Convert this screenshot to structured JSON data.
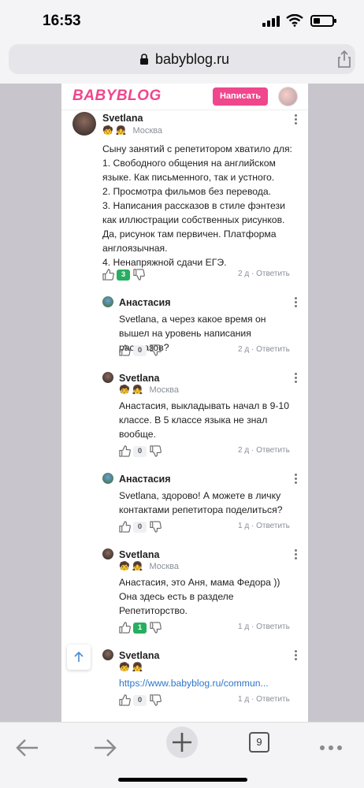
{
  "status": {
    "time": "16:53",
    "battery_level": 0.35
  },
  "browser": {
    "url": "babyblog.ru",
    "tab_count": "9"
  },
  "site": {
    "logo": "BABYBLOG",
    "write_button": "Написать"
  },
  "comments": [
    {
      "author": "Svetlana",
      "badges": "🧒 👧",
      "city": "Москва",
      "text": "Сыну занятий с репетитором хватило для:\n1. Свободного общения на английском языке. Как письменного, так и устного.\n2. Просмотра фильмов без перевода.\n3. Написания рассказов в стиле фэнтези как иллюстрации собственных рисунков. Да, рисунок там первичен. Платформа англоязычная.\n4. Ненапряжной сдачи ЕГЭ.",
      "likes": "3",
      "time": "2 д",
      "reply": "Ответить"
    },
    {
      "author": "Анастасия",
      "text": "Svetlana, а через какое время он вышел на уровень написания рассказов?",
      "likes": "0",
      "time": "2 д",
      "reply": "Ответить"
    },
    {
      "author": "Svetlana",
      "badges": "🧒 👧",
      "city": "Москва",
      "text": "Анастасия, выкладывать начал в 9-10 классе. В 5 классе языка не знал вообще.",
      "likes": "0",
      "time": "2 д",
      "reply": "Ответить"
    },
    {
      "author": "Анастасия",
      "text": "Svetlana, здорово! А можете в личку контактами репетитора поделиться?",
      "likes": "0",
      "time": "1 д",
      "reply": "Ответить"
    },
    {
      "author": "Svetlana",
      "badges": "🧒 👧",
      "city": "Москва",
      "text": "Анастасия, это Аня, мама Федора ))\nОна здесь есть в разделе Репетиторство.",
      "likes": "1",
      "time": "1 д",
      "reply": "Ответить"
    },
    {
      "author": "Svetlana",
      "badges": "🧒 👧",
      "city": "",
      "text": "https://www.babyblog.ru/commun...",
      "likes": "0",
      "time": "1 д",
      "reply": "Ответить"
    }
  ],
  "separator": "·",
  "colors": {
    "brand_pink": "#f0468c",
    "link_blue": "#2d76c9",
    "like_green": "#27ae60"
  }
}
